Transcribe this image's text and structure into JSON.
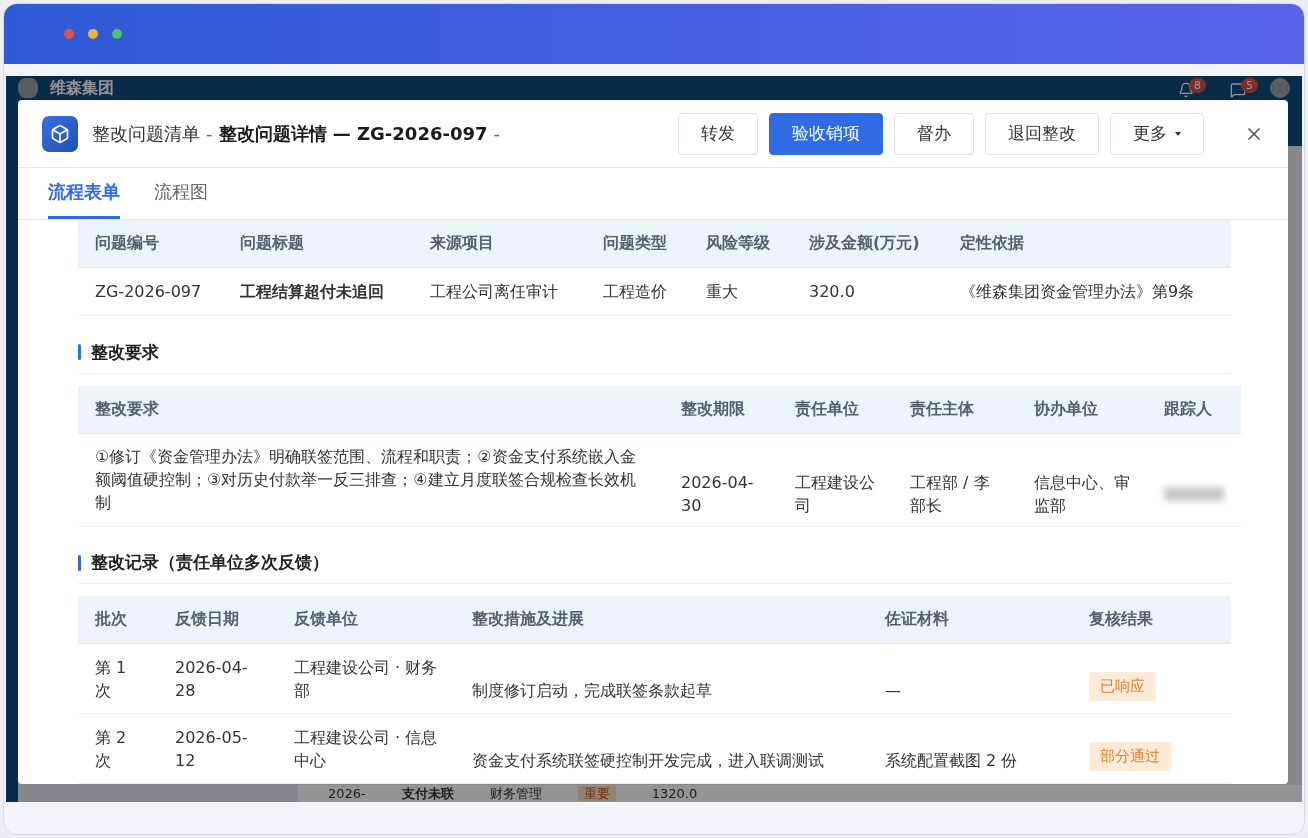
{
  "window_controls": [
    {
      "color": "#e0524b"
    },
    {
      "color": "#e9b23a"
    },
    {
      "color": "#4cc26a"
    }
  ],
  "background_app": {
    "brand": "维森集团",
    "badges": [
      "8",
      "5"
    ],
    "row": [
      "2026-",
      "支付未联",
      "财务管理",
      "重要",
      "1320.0"
    ]
  },
  "dialog": {
    "breadcrumb": "整改问题清单",
    "separator": "-",
    "title": "整改问题详情 — ZG-2026-097",
    "trailing": "-",
    "actions": [
      {
        "label": "转发",
        "primary": false,
        "dropdown": false
      },
      {
        "label": "验收销项",
        "primary": true,
        "dropdown": false
      },
      {
        "label": "督办",
        "primary": false,
        "dropdown": false
      },
      {
        "label": "退回整改",
        "primary": false,
        "dropdown": false
      },
      {
        "label": "更多",
        "primary": false,
        "dropdown": true
      }
    ],
    "tabs": [
      {
        "label": "流程表单",
        "selected": true
      },
      {
        "label": "流程图",
        "selected": false
      }
    ],
    "issue_table": {
      "columns": [
        {
          "label": "问题编号",
          "emphasis": false
        },
        {
          "label": "问题标题",
          "emphasis": true
        },
        {
          "label": "来源项目",
          "emphasis": false
        },
        {
          "label": "问题类型",
          "emphasis": false
        },
        {
          "label": "风险等级",
          "emphasis": false
        },
        {
          "label": "涉及金额(万元)",
          "emphasis": false
        },
        {
          "label": "定性依据",
          "emphasis": false
        }
      ],
      "rows": [
        [
          "ZG-2026-097",
          "工程结算超付未追回",
          "工程公司离任审计",
          "工程造价",
          "重大",
          "320.0",
          "《维森集团资金管理办法》第9条"
        ]
      ]
    },
    "requirements": {
      "title": "整改要求",
      "columns": [
        "整改要求",
        "整改期限",
        "责任单位",
        "责任主体",
        "协办单位",
        "跟踪人"
      ],
      "rows": [
        {
          "cells": [
            "①修订《资金管理办法》明确联签范围、流程和职责；②资金支付系统嵌入金额阈值硬控制；③对历史付款举一反三排查；④建立月度联签合规检查长效机制",
            "2026-04-30",
            "工程建设公司",
            "工程部 / 李部长",
            "信息中心、审监部"
          ],
          "tracker_redacted": true
        }
      ]
    },
    "records": {
      "title": "整改记录（责任单位多次反馈）",
      "columns": [
        "批次",
        "反馈日期",
        "反馈单位",
        "整改措施及进展",
        "佐证材料",
        "复核结果"
      ],
      "rows": [
        {
          "cells": [
            "第 1 次",
            "2026-04-28",
            "工程建设公司 · 财务部",
            "制度修订启动，完成联签条款起草",
            "—"
          ],
          "result": "已响应"
        },
        {
          "cells": [
            "第 2 次",
            "2026-05-12",
            "工程建设公司 · 信息中心",
            "资金支付系统联签硬控制开发完成，进入联调测试",
            "系统配置截图 2 份"
          ],
          "result": "部分通过"
        }
      ]
    }
  }
}
